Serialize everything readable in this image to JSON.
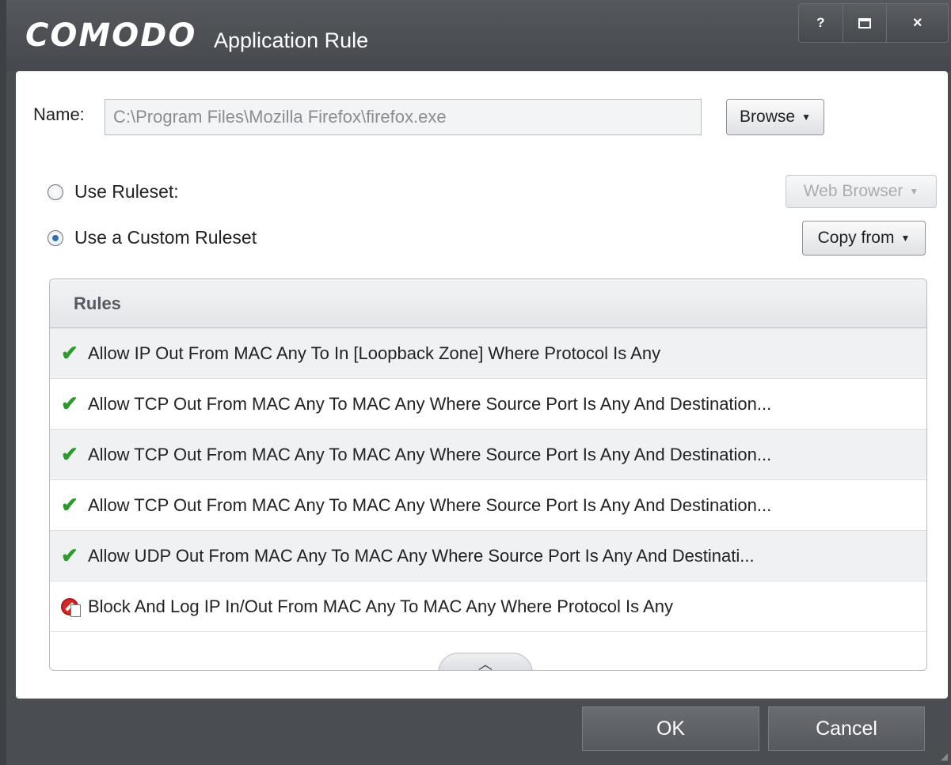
{
  "window": {
    "brand": "COMODO",
    "title": "Application Rule",
    "controls": {
      "help": "?",
      "close": "×"
    }
  },
  "name_field": {
    "label": "Name:",
    "value": "C:\\Program Files\\Mozilla Firefox\\firefox.exe",
    "browse_label": "Browse"
  },
  "ruleset": {
    "use_ruleset_label": "Use Ruleset:",
    "use_ruleset_selected": false,
    "ruleset_dropdown": "Web Browser",
    "custom_label": "Use a Custom Ruleset",
    "custom_selected": true,
    "copy_from_label": "Copy from"
  },
  "rules": {
    "header": "Rules",
    "items": [
      {
        "icon": "allow-check-icon",
        "text": "Allow IP Out From MAC Any To In [Loopback Zone] Where Protocol Is Any"
      },
      {
        "icon": "allow-check-icon",
        "text": "Allow TCP Out From MAC Any To MAC Any Where Source Port Is Any And Destination..."
      },
      {
        "icon": "allow-check-icon",
        "text": "Allow TCP Out From MAC Any To MAC Any Where Source Port Is Any And Destination..."
      },
      {
        "icon": "allow-check-icon",
        "text": "Allow TCP Out From MAC Any To MAC Any Where Source Port Is Any And Destination..."
      },
      {
        "icon": "allow-check-icon",
        "text": "Allow UDP Out From MAC Any To MAC Any Where Source Port Is Any And Destinati..."
      },
      {
        "icon": "block-log-icon",
        "text": "Block And Log IP In/Out From MAC Any To MAC Any Where Protocol Is Any"
      }
    ]
  },
  "footer": {
    "ok_label": "OK",
    "cancel_label": "Cancel"
  },
  "colors": {
    "titlebar": "#4a4d52",
    "allow": "#2a9a2a",
    "block": "#d02a2a",
    "radio_selected": "#2f6fb6"
  }
}
